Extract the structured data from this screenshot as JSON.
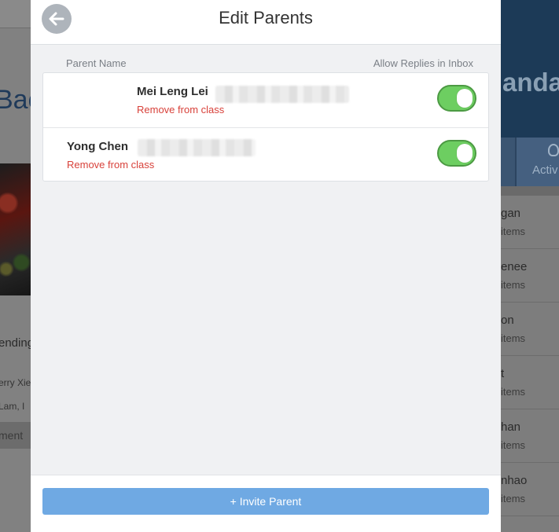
{
  "background": {
    "left_title": "Bac",
    "left_text_1": "ending",
    "left_text_2": "erry Xie",
    "left_text_3": "Lam, I",
    "left_button": "ment",
    "right_title": "anda",
    "right_tab": "Activ",
    "right_rows": [
      {
        "name": "gan",
        "count": "items"
      },
      {
        "name": "enee",
        "count": "items"
      },
      {
        "name": "on",
        "count": "items"
      },
      {
        "name": "t",
        "count": "items"
      },
      {
        "name": "han",
        "count": "items"
      },
      {
        "name": "nhao",
        "count": "items"
      }
    ]
  },
  "modal": {
    "title": "Edit Parents",
    "back_icon": "arrow-left-icon",
    "columns": {
      "name": "Parent Name",
      "replies": "Allow Replies in Inbox"
    },
    "parents": [
      {
        "name": "Mei Leng Lei",
        "remove_label": "Remove from class",
        "allow_replies": true
      },
      {
        "name": "Yong Chen",
        "remove_label": "Remove from class",
        "allow_replies": true
      }
    ],
    "invite_label": "+ Invite Parent"
  },
  "colors": {
    "toggle_on": "#6dce61",
    "remove_link": "#d8413a",
    "invite_button": "#6fa9e3"
  }
}
